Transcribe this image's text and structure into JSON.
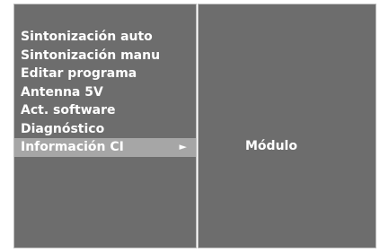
{
  "menu": {
    "items": [
      {
        "label": "Sintonización auto"
      },
      {
        "label": "Sintonización manu"
      },
      {
        "label": "Editar programa"
      },
      {
        "label": "Antenna 5V"
      },
      {
        "label": "Act. software"
      },
      {
        "label": "Diagnóstico"
      },
      {
        "label": "Información CI",
        "arrow": "►",
        "selected": true
      }
    ]
  },
  "submenu": {
    "label": "Módulo"
  },
  "icons": {
    "submenu_arrow": "right-triangle-icon"
  },
  "colors": {
    "panel_bg": "#6d6d6d",
    "selected_bg": "#a6a6a6",
    "text": "#ffffff"
  }
}
